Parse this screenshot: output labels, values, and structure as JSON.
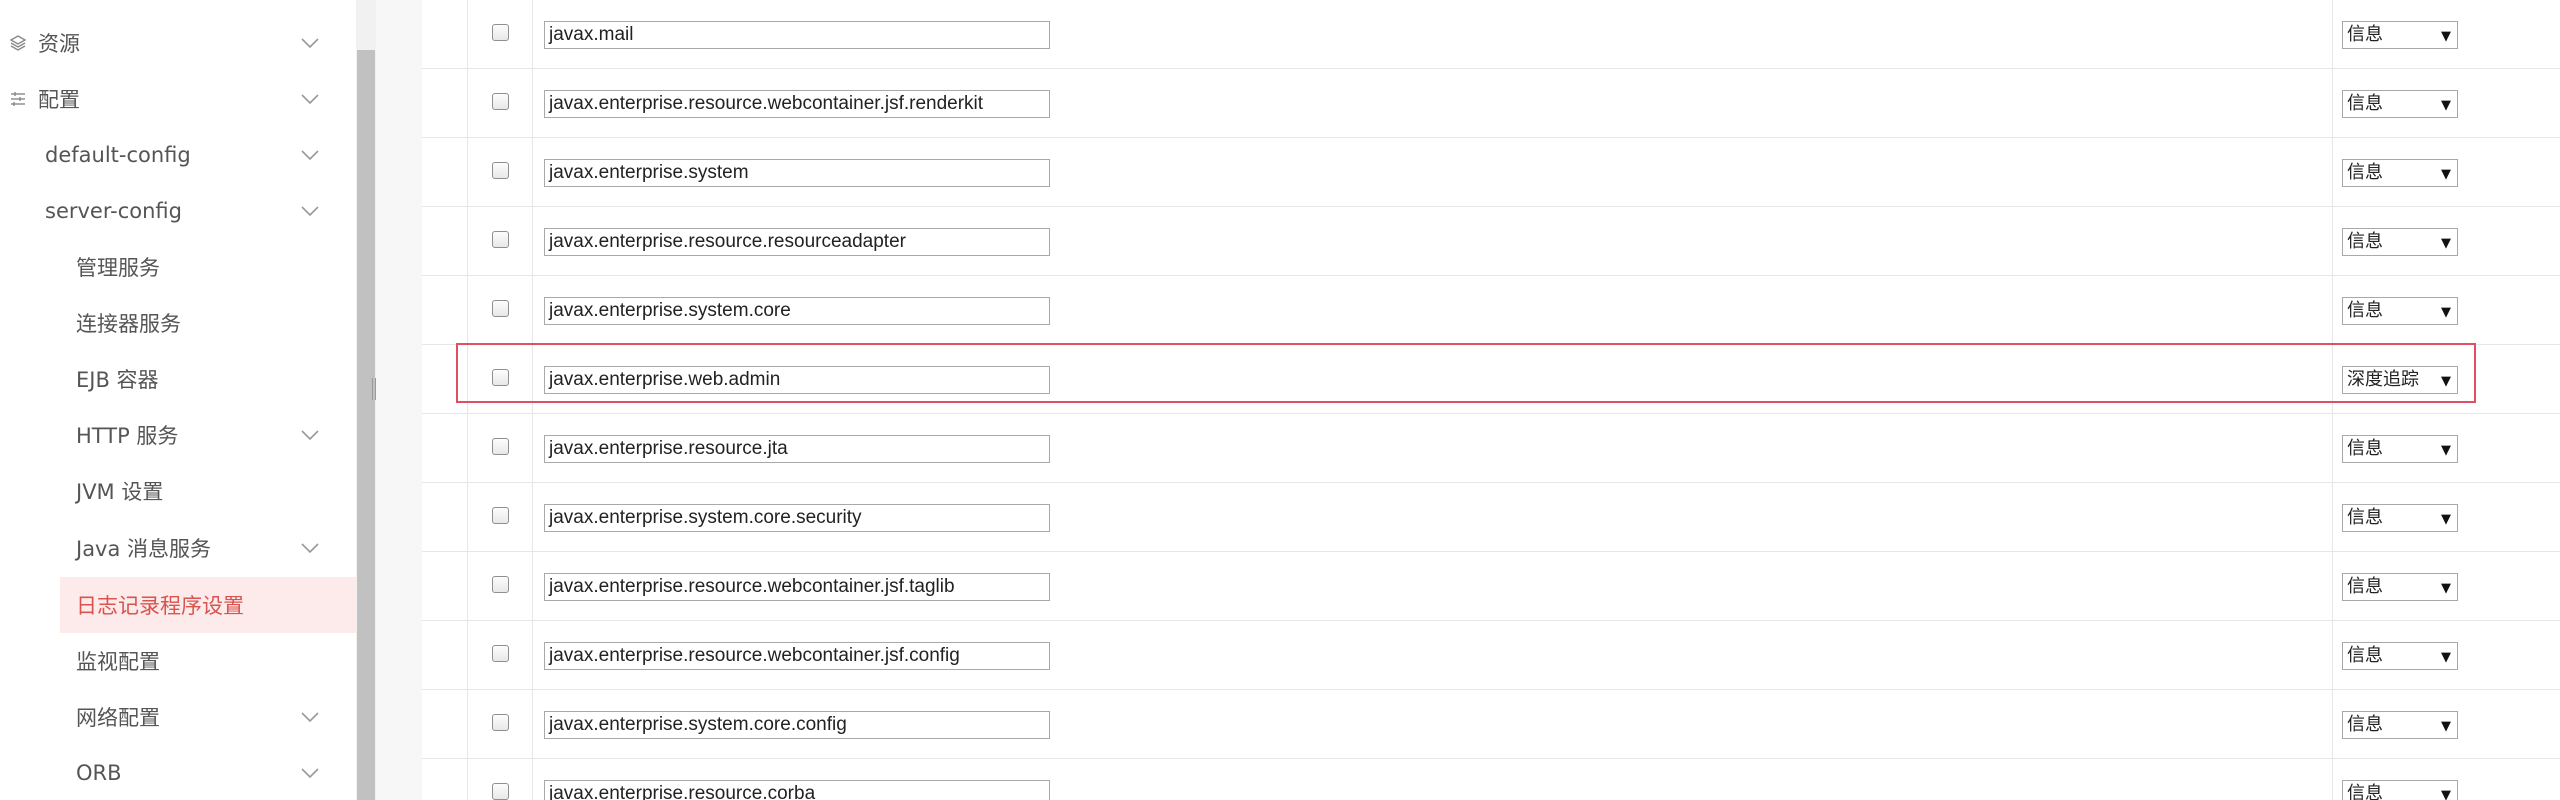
{
  "sidebar": {
    "items": [
      {
        "label": "资源",
        "level": 0,
        "icon": "layers-icon",
        "chevron": true
      },
      {
        "label": "配置",
        "level": 0,
        "icon": "sliders-icon",
        "chevron": true
      },
      {
        "label": "default-config",
        "level": 1,
        "chevron": true
      },
      {
        "label": "server-config",
        "level": 1,
        "chevron": true
      },
      {
        "label": "管理服务",
        "level": 2,
        "chevron": false
      },
      {
        "label": "连接器服务",
        "level": 2,
        "chevron": false
      },
      {
        "label": "EJB 容器",
        "level": 2,
        "chevron": false
      },
      {
        "label": "HTTP 服务",
        "level": 2,
        "chevron": true
      },
      {
        "label": "JVM 设置",
        "level": 2,
        "chevron": false
      },
      {
        "label": "Java 消息服务",
        "level": 2,
        "chevron": true
      },
      {
        "label": "日志记录程序设置",
        "level": 2,
        "chevron": false,
        "active": true
      },
      {
        "label": "监视配置",
        "level": 2,
        "chevron": false
      },
      {
        "label": "网络配置",
        "level": 2,
        "chevron": true
      },
      {
        "label": "ORB",
        "level": 2,
        "chevron": true
      }
    ]
  },
  "loggers": [
    {
      "name": "javax.mail",
      "level": "信息"
    },
    {
      "name": "javax.enterprise.resource.webcontainer.jsf.renderkit",
      "level": "信息"
    },
    {
      "name": "javax.enterprise.system",
      "level": "信息"
    },
    {
      "name": "javax.enterprise.resource.resourceadapter",
      "level": "信息"
    },
    {
      "name": "javax.enterprise.system.core",
      "level": "信息"
    },
    {
      "name": "javax.enterprise.web.admin",
      "level": "深度追踪",
      "highlighted": true
    },
    {
      "name": "javax.enterprise.resource.jta",
      "level": "信息"
    },
    {
      "name": "javax.enterprise.system.core.security",
      "level": "信息"
    },
    {
      "name": "javax.enterprise.resource.webcontainer.jsf.taglib",
      "level": "信息"
    },
    {
      "name": "javax.enterprise.resource.webcontainer.jsf.config",
      "level": "信息"
    },
    {
      "name": "javax.enterprise.system.core.config",
      "level": "信息"
    },
    {
      "name": "javax.enterprise.resource.corba",
      "level": "信息"
    }
  ],
  "colors": {
    "active_bg": "#fdeaea",
    "active_text": "#d9534f",
    "highlight_border": "#e05060"
  }
}
